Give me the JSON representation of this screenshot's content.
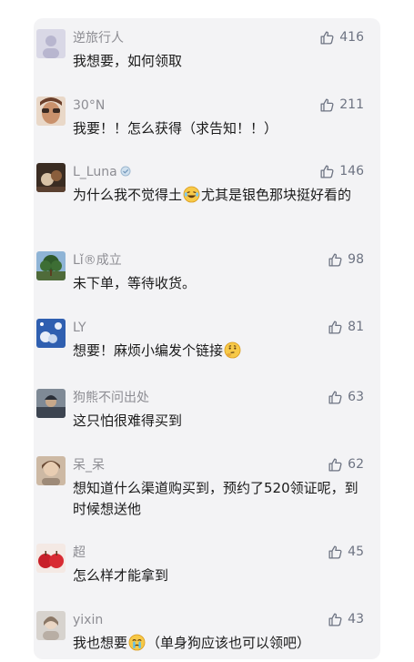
{
  "comments": [
    {
      "user": "逆旅行人",
      "text": "我想要，如何领取",
      "likes": "416"
    },
    {
      "user": "30°N",
      "text": "我要！！怎么获得（求告知！！）",
      "likes": "211"
    },
    {
      "user": "L_Luna",
      "text_a": "为什么我不觉得土",
      "text_b": "尤其是银色那块挺好看的",
      "likes": "146"
    },
    {
      "user": "Lǐ®成立",
      "text": "未下单，等待收货。",
      "likes": "98"
    },
    {
      "user": "LY",
      "text": "想要！麻烦小编发个链接",
      "likes": "81"
    },
    {
      "user": "狗熊不问出处",
      "text": "这只怕很难得买到",
      "likes": "63"
    },
    {
      "user": "呆_呆",
      "text": "想知道什么渠道购买到，预约了520领证呢，到时候想送他",
      "likes": "62"
    },
    {
      "user": "超",
      "text": "怎么样才能拿到",
      "likes": "45"
    },
    {
      "user": "yixin",
      "text_a": "我也想要",
      "text_b": "（单身狗应该也可以领吧）",
      "likes": "43"
    }
  ],
  "colors": {
    "card_bg": "#f3f3f5",
    "username": "#8d8d93",
    "text": "#1a1a1a",
    "like": "#6d7382"
  },
  "icons": {
    "like": "thumbs-up-icon",
    "laugh": "laughing-emoji-icon",
    "thinking": "thinking-emoji-icon",
    "sad": "crying-emoji-icon"
  }
}
